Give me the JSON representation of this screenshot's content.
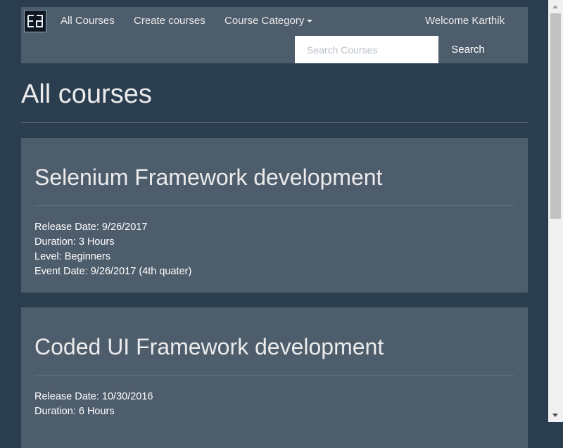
{
  "navbar": {
    "links": [
      "All Courses",
      "Create courses",
      "Course Category"
    ],
    "welcome": "Welcome Karthik",
    "search": {
      "placeholder": "Search Courses",
      "value": "",
      "button": "Search"
    }
  },
  "page_title": "All courses",
  "courses": [
    {
      "title": "Selenium Framework development",
      "details": [
        "Release Date: 9/26/2017",
        "Duration: 3 Hours",
        "Level: Beginners",
        "Event Date: 9/26/2017 (4th quater)"
      ]
    },
    {
      "title": "Coded UI Framework development",
      "details": [
        "Release Date: 10/30/2016",
        "Duration: 6 Hours"
      ]
    }
  ],
  "colors": {
    "background": "#2b3e50",
    "panel": "#4e5d6c",
    "text": "#ebebeb"
  },
  "icons": {
    "logo": "ea-logo-icon",
    "category_caret": "caret-down-icon"
  }
}
